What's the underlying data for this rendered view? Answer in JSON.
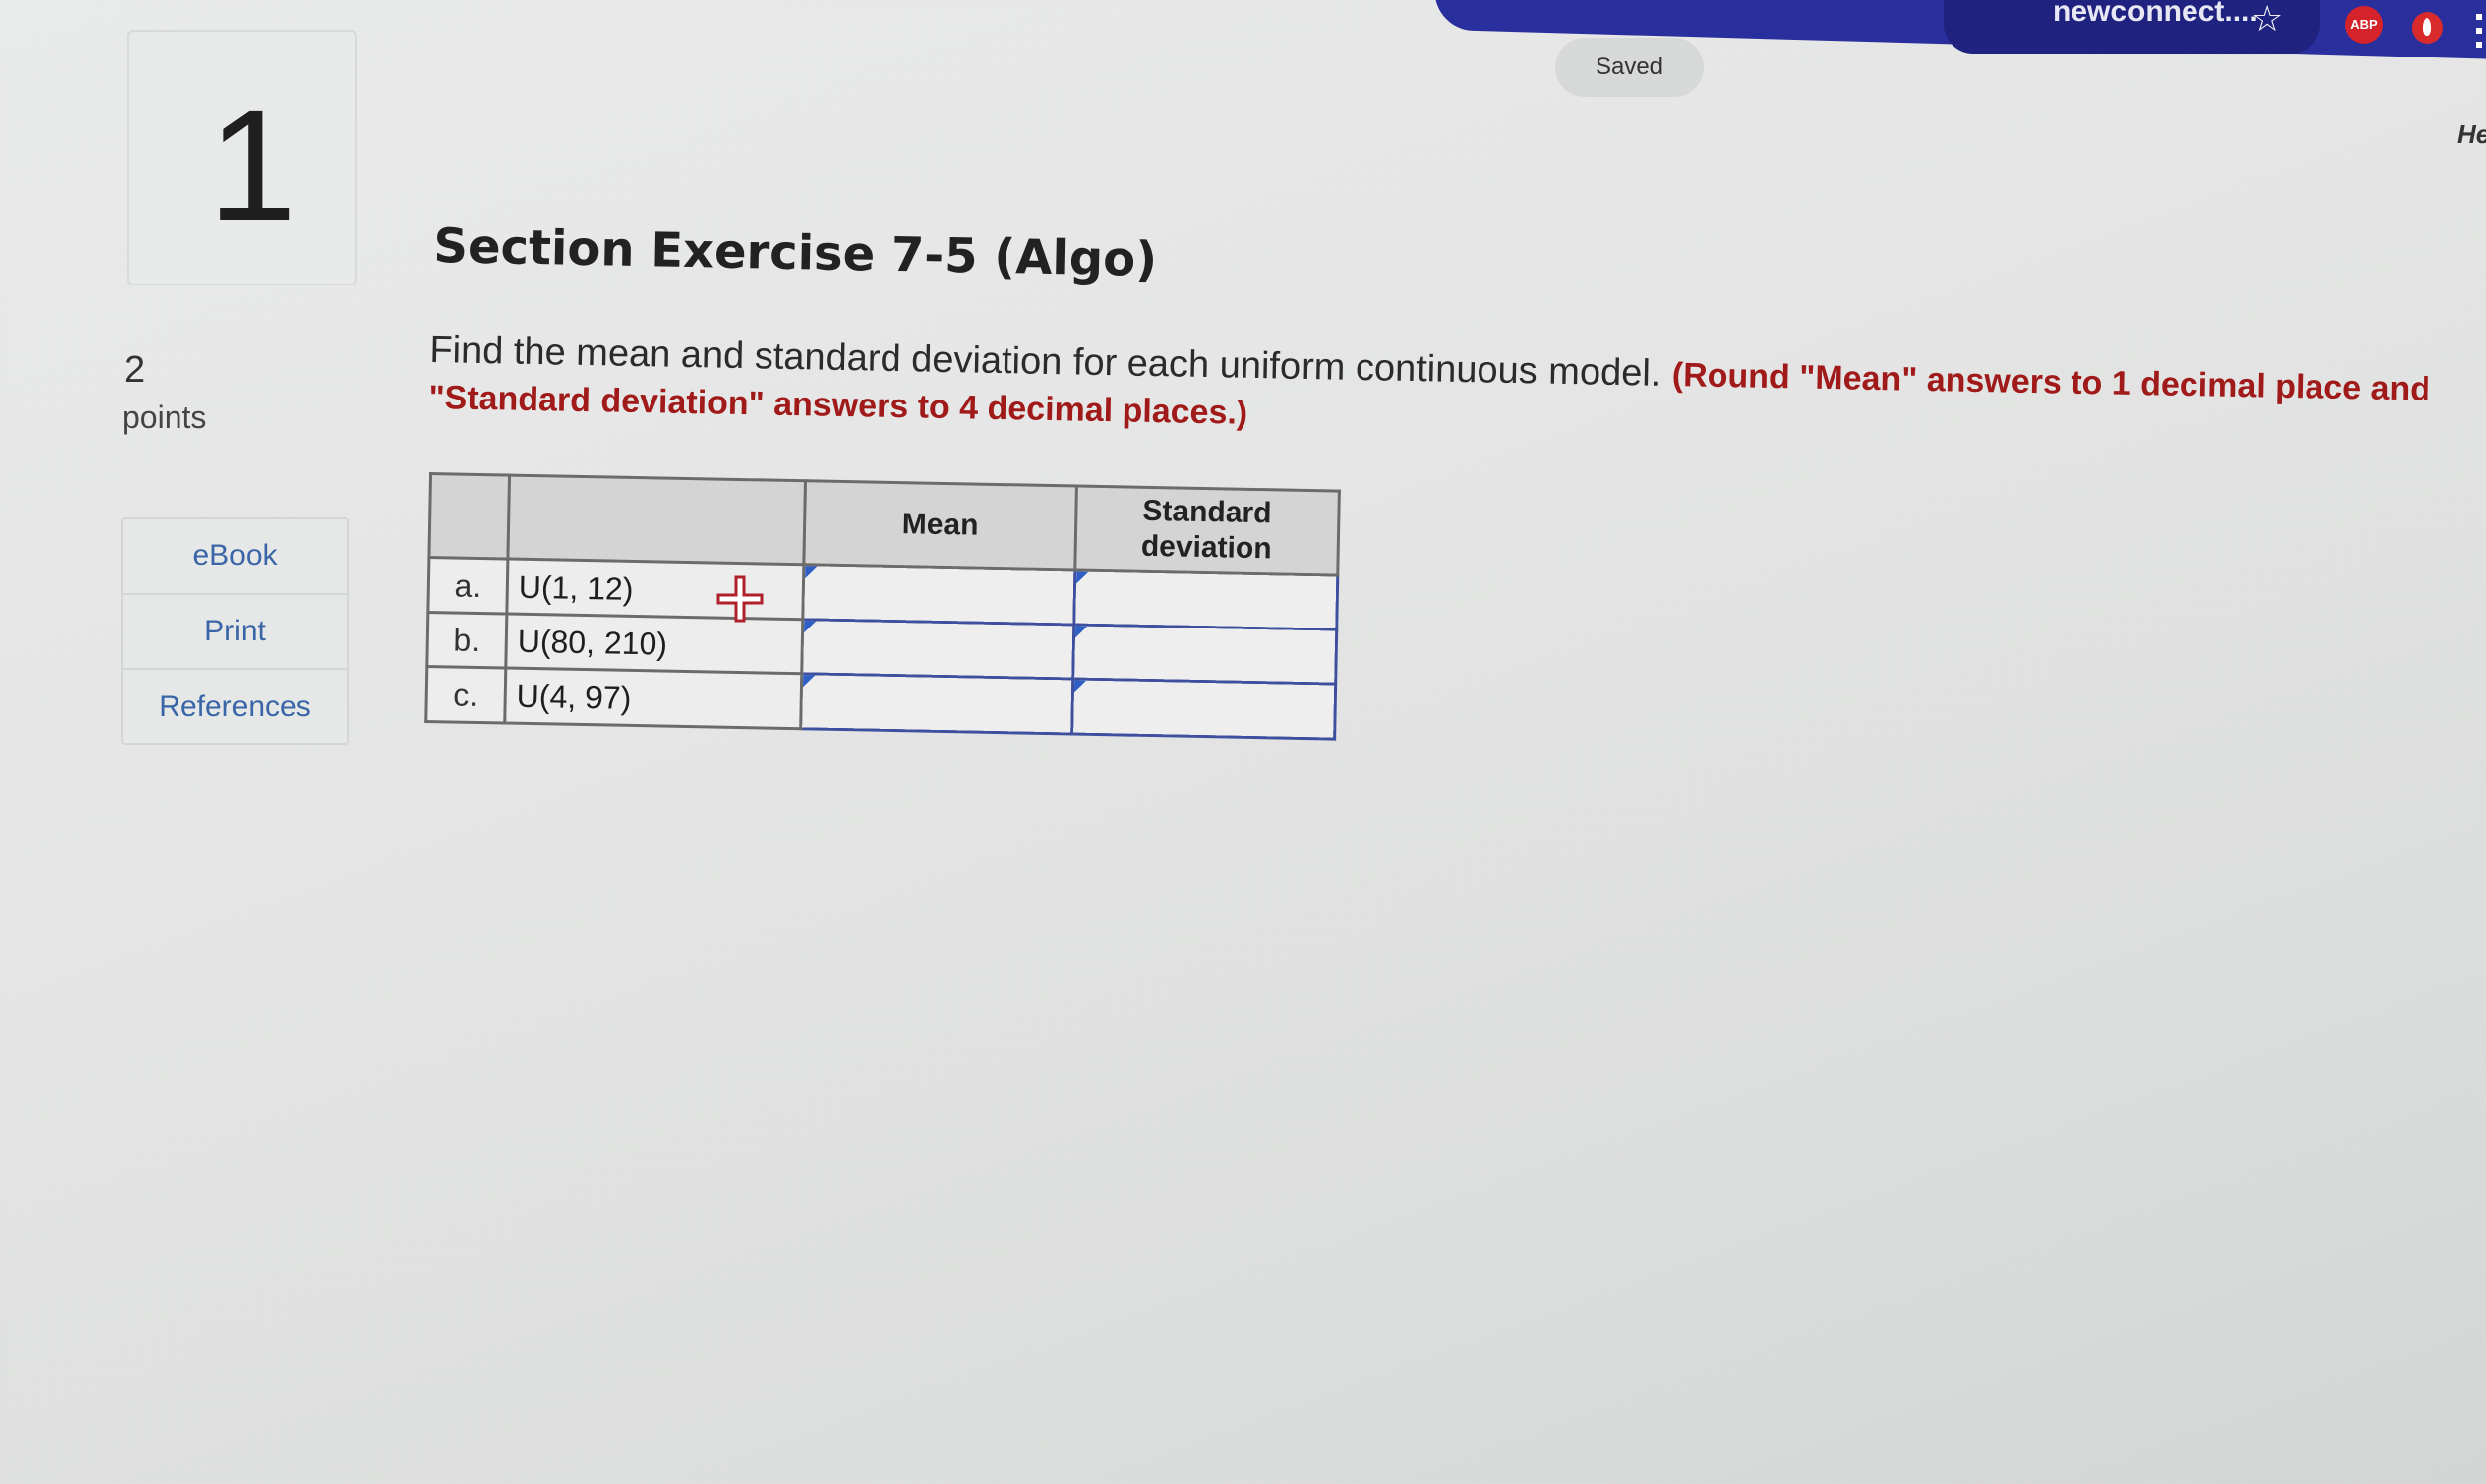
{
  "browser": {
    "url_text": "newconnect....",
    "abp_label": "ABP",
    "icons": [
      "star-icon",
      "adblock-icon",
      "extension-icon",
      "menu-icon"
    ]
  },
  "status": {
    "saved_label": "Saved"
  },
  "help_link": "He",
  "question": {
    "number": "1",
    "points_value": "2",
    "points_label": "points",
    "title": "Section Exercise 7-5 (Algo)",
    "prompt": "Find the mean and standard deviation for each uniform continuous model.",
    "instruction": "(Round \"Mean\" answers to 1 decimal place and \"Standard deviation\" answers to 4 decimal places.)"
  },
  "side_menu": {
    "items": [
      {
        "label": "eBook"
      },
      {
        "label": "Print"
      },
      {
        "label": "References"
      }
    ]
  },
  "table": {
    "headers": {
      "letter": "",
      "model": "",
      "mean": "Mean",
      "sd_line1": "Standard",
      "sd_line2": "deviation"
    },
    "rows": [
      {
        "letter": "a.",
        "model": "U(1, 12)",
        "mean": "",
        "sd": ""
      },
      {
        "letter": "b.",
        "model": "U(80, 210)",
        "mean": "",
        "sd": ""
      },
      {
        "letter": "c.",
        "model": "U(4, 97)",
        "mean": "",
        "sd": ""
      }
    ]
  },
  "colors": {
    "instruction_red": "#a11a1a",
    "link_blue": "#3a66a8",
    "input_border": "#3d4f9e",
    "browser_blue": "#2a2f9e"
  }
}
